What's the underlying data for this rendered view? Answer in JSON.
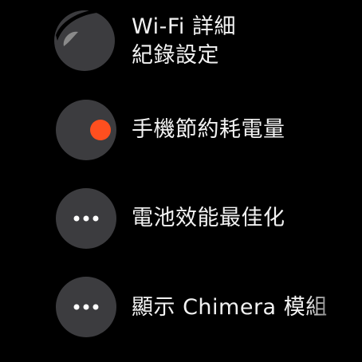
{
  "colors": {
    "background": "#000000",
    "icon_background": "#3c3c3f",
    "accent": "#ff4f1f",
    "icon_highlight": "#8a8a8a",
    "text": "#f2f2f2"
  },
  "items": [
    {
      "label_line1": "Wi-Fi 詳細",
      "label_line2": "紀錄設定",
      "icon": "partial-circle-icon"
    },
    {
      "label": "手機節約耗電量",
      "icon": "toggle-on-icon"
    },
    {
      "label": "電池效能最佳化",
      "icon": "more-horizontal-icon"
    },
    {
      "label": "顯示 Chimera 模組",
      "icon": "more-horizontal-icon"
    }
  ]
}
